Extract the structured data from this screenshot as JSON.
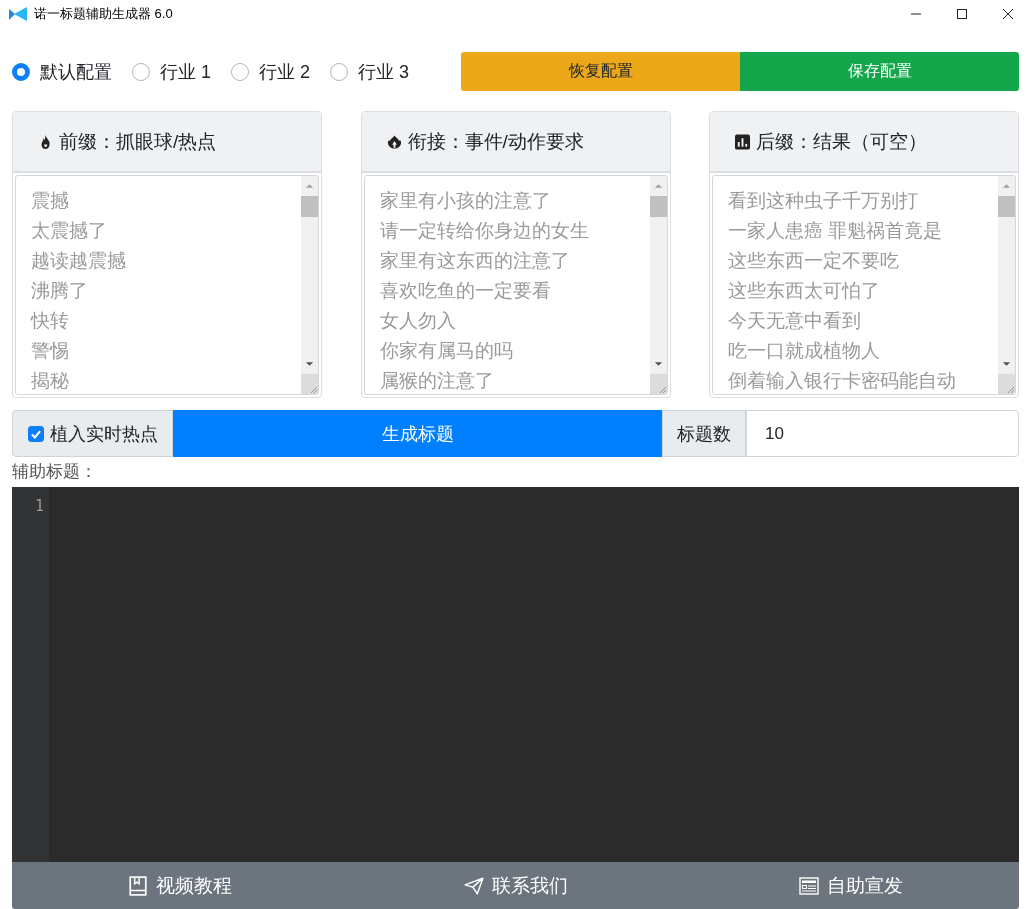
{
  "window": {
    "title": "诺一标题辅助生成器 6.0"
  },
  "configs": [
    {
      "label": "默认配置",
      "selected": true
    },
    {
      "label": "行业 1",
      "selected": false
    },
    {
      "label": "行业 2",
      "selected": false
    },
    {
      "label": "行业 3",
      "selected": false
    }
  ],
  "config_buttons": [
    {
      "label": "恢复配置",
      "kind": "restore"
    },
    {
      "label": "保存配置",
      "kind": "save"
    }
  ],
  "panels": [
    {
      "title": "前缀：抓眼球/热点",
      "placeholder": [
        "震撼",
        "太震撼了",
        "越读越震撼",
        "沸腾了",
        "快转",
        "警惕",
        "揭秘"
      ]
    },
    {
      "title": "衔接：事件/动作要求",
      "placeholder": [
        "家里有小孩的注意了",
        "请一定转给你身边的女生",
        "家里有这东西的注意了",
        "喜欢吃鱼的一定要看",
        "女人勿入",
        "你家有属马的吗",
        "属猴的注意了"
      ]
    },
    {
      "title": "后缀：结果（可空）",
      "placeholder": [
        "看到这种虫子千万别打",
        "一家人患癌 罪魁祸首竟是",
        "这些东西一定不要吃",
        "这些东西太可怕了",
        "今天无意中看到",
        "吃一口就成植物人",
        "倒着输入银行卡密码能自动"
      ]
    }
  ],
  "hotspot": {
    "label": "植入实时热点",
    "checked": true
  },
  "generate_button": "生成标题",
  "count": {
    "label": "标题数",
    "value": "10"
  },
  "output_label": "辅助标题：",
  "editor": {
    "line_numbers": [
      "1"
    ]
  },
  "footer": [
    {
      "label": "视频教程"
    },
    {
      "label": "联系我们"
    },
    {
      "label": "自助宣发"
    }
  ]
}
